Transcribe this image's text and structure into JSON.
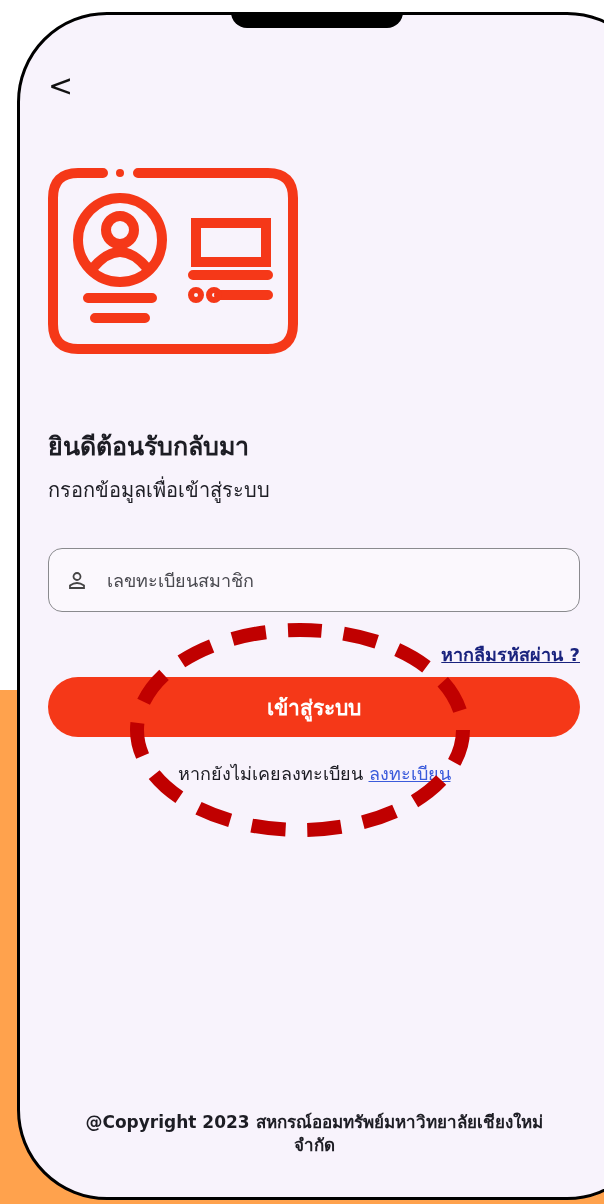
{
  "back_button": {
    "label": "<"
  },
  "header": {
    "title": "ยินดีต้อนรับกลับมา",
    "subtitle": "กรอกข้อมูลเพื่อเข้าสู่ระบบ"
  },
  "member_field": {
    "placeholder": "เลขทะเบียนสมาชิก"
  },
  "forgot_link": "หากลืมรหัสผ่าน ?",
  "login_button": "เข้าสู่ระบบ",
  "register": {
    "text": "หากยังไม่เคยลงทะเบียน",
    "link": "ลงทะเบียน"
  },
  "footer": "@Copyright 2023 สหกรณ์ออมทรัพย์มหาวิทยาลัยเชียงใหม่ จำกัด"
}
